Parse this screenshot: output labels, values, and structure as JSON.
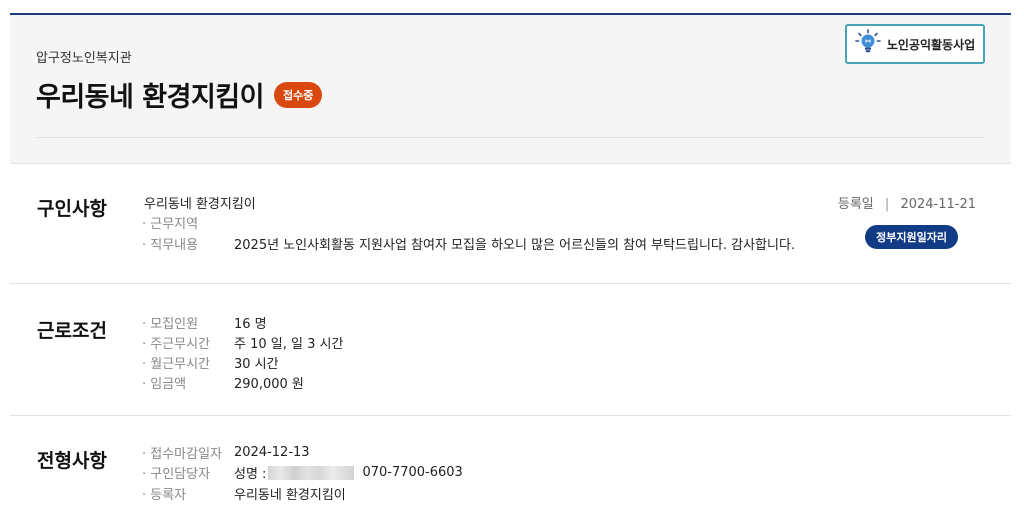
{
  "header": {
    "org_name": "압구정노인복지관",
    "title": "우리동네 환경지킴이",
    "status_badge": "접수중",
    "category_button": "노인공익활동사업"
  },
  "recruit": {
    "section_title": "구인사항",
    "job_name": "우리동네 환경지킴이",
    "location_label": "· 근무지역",
    "location_value": "",
    "duty_label": "· 직무내용",
    "duty_value": "2025년 노인사회활동 지원사업 참여자 모집을 하오니 많은 어르신들의 참여 부탁드립니다. 감사합니다.",
    "reg_date_label": "등록일",
    "reg_date_sep": "|",
    "reg_date_value": "2024-11-21",
    "gov_badge": "정부지원일자리"
  },
  "conditions": {
    "section_title": "근로조건",
    "rows": [
      {
        "label": "· 모집인원",
        "value": "16 명"
      },
      {
        "label": "· 주근무시간",
        "value": "주 10 일, 일 3 시간"
      },
      {
        "label": "· 월근무시간",
        "value": "30 시간"
      },
      {
        "label": "· 임금액",
        "value": "290,000 원"
      }
    ]
  },
  "screening": {
    "section_title": "전형사항",
    "deadline_label": "· 접수마감일자",
    "deadline_value": "2024-12-13",
    "contact_label": "· 구인담당자",
    "contact_name_prefix": "성명 :",
    "contact_phone": "070-7700-6603",
    "registrant_label": "· 등록자",
    "registrant_value": "우리동네 환경지킴이"
  },
  "colors": {
    "status_badge": "#d9480f",
    "gov_badge": "#123b85",
    "header_top_border": "#1f3a78",
    "category_border": "#4aa3b5"
  },
  "icons": {
    "category": "lightbulb-icon"
  }
}
